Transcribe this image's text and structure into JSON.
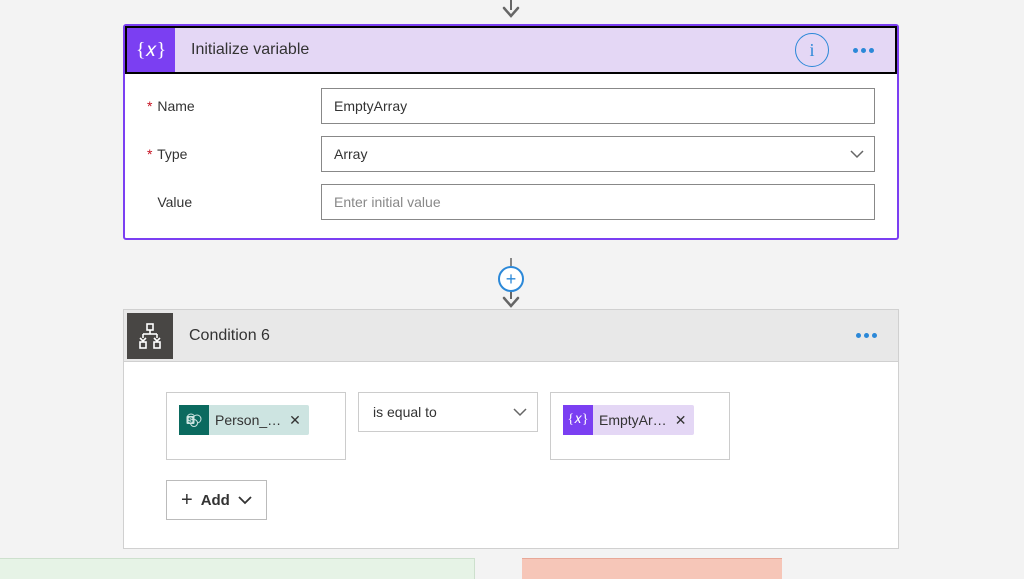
{
  "initVariable": {
    "title": "Initialize variable",
    "fields": {
      "nameLabel": "Name",
      "nameValue": "EmptyArray",
      "typeLabel": "Type",
      "typeValue": "Array",
      "valueLabel": "Value",
      "valuePlaceholder": "Enter initial value"
    }
  },
  "condition": {
    "title": "Condition 6",
    "leftToken": "Person_…",
    "operator": "is equal to",
    "rightToken": "EmptyAr…",
    "addLabel": "Add"
  },
  "icons": {
    "varCurly": "{𝑥}",
    "info": "i",
    "plus": "+",
    "close": "✕"
  }
}
